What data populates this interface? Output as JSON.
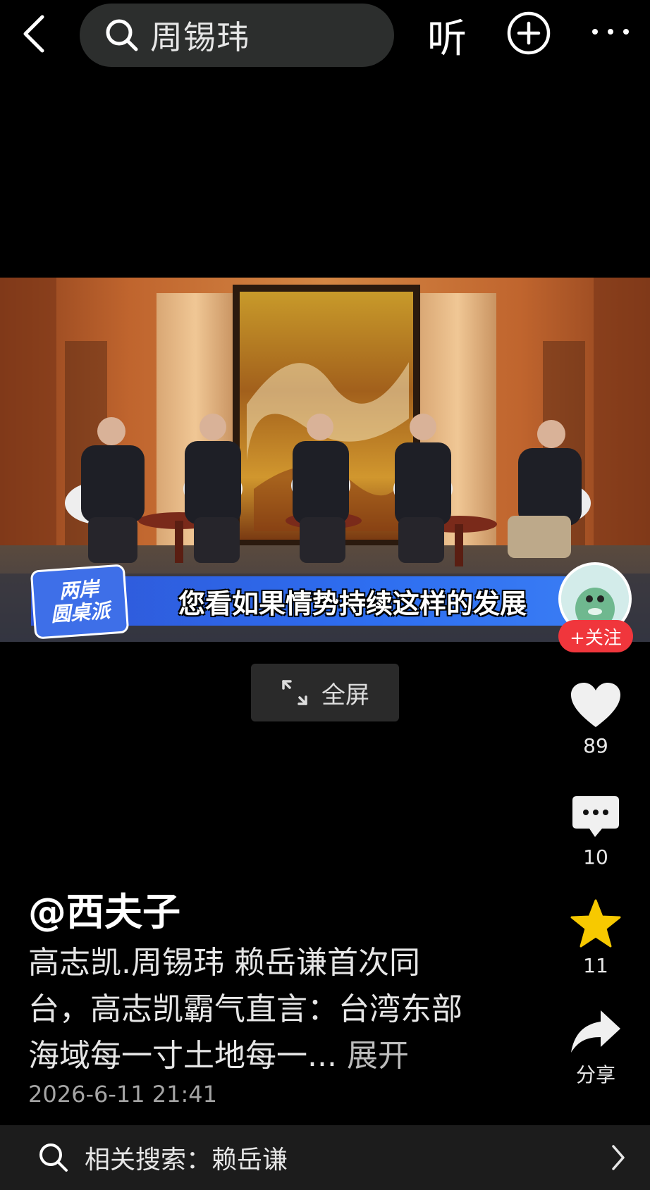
{
  "topbar": {
    "search_query": "周锡玮",
    "listen_label": "听"
  },
  "video": {
    "subtitle": "您看如果情势持续这样的发展",
    "show_logo_line1": "两岸",
    "show_logo_line2": "圆桌派",
    "fullscreen_label": "全屏"
  },
  "author_panel": {
    "follow_label": "+关注"
  },
  "actions": {
    "likes": "89",
    "comments": "10",
    "favorites": "11",
    "share_label": "分享"
  },
  "post": {
    "author": "@西夫子",
    "description": "高志凯.周锡玮 赖岳谦首次同台，高志凯霸气直言：台湾东部海域每一寸土地每一...",
    "expand_label": "展开",
    "date": "2026-6-11 21:41"
  },
  "related_search": {
    "label": "相关搜索：赖岳谦"
  },
  "colors": {
    "background": "#000000",
    "follow_red": "#f0363c",
    "favorite_yellow": "#f7c900",
    "subtitle_blue": "#2e6ef0"
  }
}
